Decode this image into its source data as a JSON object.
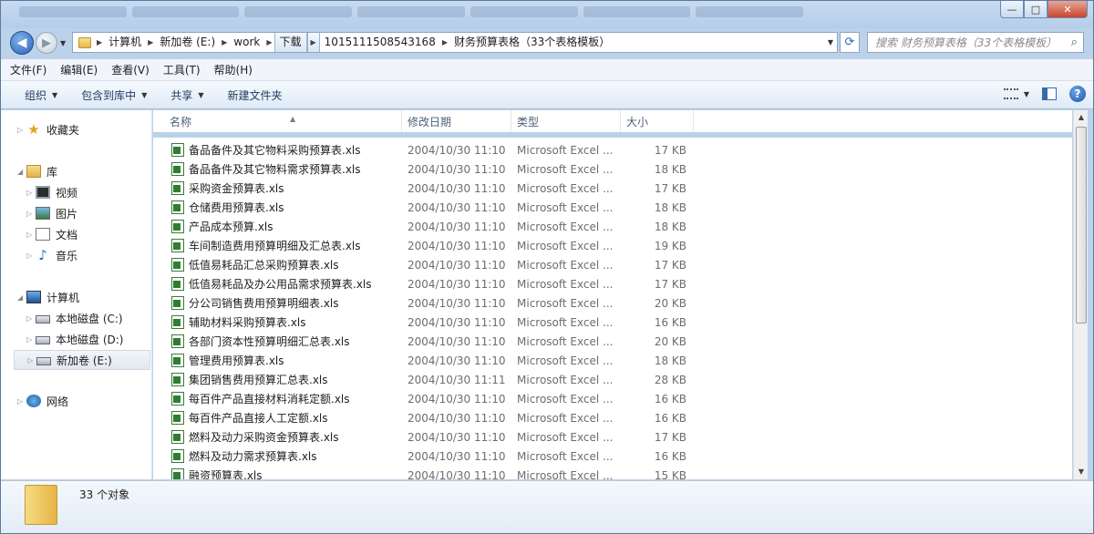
{
  "window": {
    "minimize": "—",
    "maximize": "□",
    "close": "✕"
  },
  "address": {
    "segments": [
      "计算机",
      "新加卷 (E:)",
      "work",
      "下载",
      "1015111508543168",
      "财务预算表格（33个表格模板）"
    ],
    "search_placeholder": "搜索 财务预算表格（33个表格模板）"
  },
  "menu": [
    "文件(F)",
    "编辑(E)",
    "查看(V)",
    "工具(T)",
    "帮助(H)"
  ],
  "toolbar": {
    "organize": "组织",
    "include": "包含到库中",
    "share": "共享",
    "new_folder": "新建文件夹"
  },
  "sidebar": {
    "favorites": "收藏夹",
    "libraries": "库",
    "lib_items": [
      "视频",
      "图片",
      "文档",
      "音乐"
    ],
    "computer": "计算机",
    "drives": [
      "本地磁盘 (C:)",
      "本地磁盘 (D:)",
      "新加卷 (E:)"
    ],
    "network": "网络"
  },
  "columns": {
    "name": "名称",
    "date": "修改日期",
    "type": "类型",
    "size": "大小"
  },
  "files": [
    {
      "name": "备品备件及其它物料采购预算表.xls",
      "date": "2004/10/30 11:10",
      "type": "Microsoft Excel ...",
      "size": "17 KB"
    },
    {
      "name": "备品备件及其它物料需求预算表.xls",
      "date": "2004/10/30 11:10",
      "type": "Microsoft Excel ...",
      "size": "18 KB"
    },
    {
      "name": "采购资金预算表.xls",
      "date": "2004/10/30 11:10",
      "type": "Microsoft Excel ...",
      "size": "17 KB"
    },
    {
      "name": "仓储费用预算表.xls",
      "date": "2004/10/30 11:10",
      "type": "Microsoft Excel ...",
      "size": "18 KB"
    },
    {
      "name": "产品成本预算.xls",
      "date": "2004/10/30 11:10",
      "type": "Microsoft Excel ...",
      "size": "18 KB"
    },
    {
      "name": "车间制造费用预算明细及汇总表.xls",
      "date": "2004/10/30 11:10",
      "type": "Microsoft Excel ...",
      "size": "19 KB"
    },
    {
      "name": "低值易耗品汇总采购预算表.xls",
      "date": "2004/10/30 11:10",
      "type": "Microsoft Excel ...",
      "size": "17 KB"
    },
    {
      "name": "低值易耗品及办公用品需求预算表.xls",
      "date": "2004/10/30 11:10",
      "type": "Microsoft Excel ...",
      "size": "17 KB"
    },
    {
      "name": "分公司销售费用预算明细表.xls",
      "date": "2004/10/30 11:10",
      "type": "Microsoft Excel ...",
      "size": "20 KB"
    },
    {
      "name": "辅助材料采购预算表.xls",
      "date": "2004/10/30 11:10",
      "type": "Microsoft Excel ...",
      "size": "16 KB"
    },
    {
      "name": "各部门资本性预算明细汇总表.xls",
      "date": "2004/10/30 11:10",
      "type": "Microsoft Excel ...",
      "size": "20 KB"
    },
    {
      "name": "管理费用预算表.xls",
      "date": "2004/10/30 11:10",
      "type": "Microsoft Excel ...",
      "size": "18 KB"
    },
    {
      "name": "集团销售费用预算汇总表.xls",
      "date": "2004/10/30 11:11",
      "type": "Microsoft Excel ...",
      "size": "28 KB"
    },
    {
      "name": "每百件产品直接材料消耗定额.xls",
      "date": "2004/10/30 11:10",
      "type": "Microsoft Excel ...",
      "size": "16 KB"
    },
    {
      "name": "每百件产品直接人工定额.xls",
      "date": "2004/10/30 11:10",
      "type": "Microsoft Excel ...",
      "size": "16 KB"
    },
    {
      "name": "燃料及动力采购资金预算表.xls",
      "date": "2004/10/30 11:10",
      "type": "Microsoft Excel ...",
      "size": "17 KB"
    },
    {
      "name": "燃料及动力需求预算表.xls",
      "date": "2004/10/30 11:10",
      "type": "Microsoft Excel ...",
      "size": "16 KB"
    },
    {
      "name": "融资预算表.xls",
      "date": "2004/10/30 11:10",
      "type": "Microsoft Excel ...",
      "size": "15 KB"
    }
  ],
  "status": {
    "count": "33 个对象"
  }
}
